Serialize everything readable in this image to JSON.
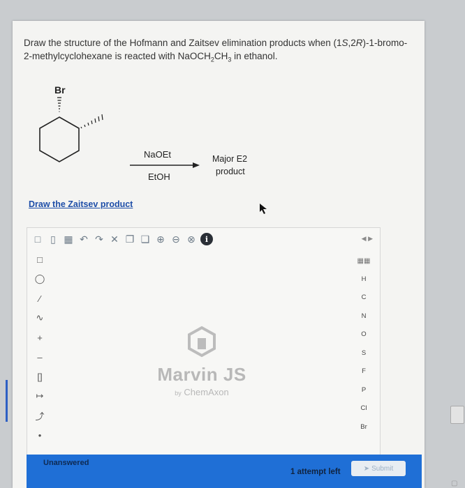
{
  "question": {
    "text_before": "Draw the structure of the Hofmann and Zaitsev elimination products when (1",
    "s_part": "S",
    "text_mid": ",2",
    "r_part": "R",
    "text_after": ")-1-bromo-2-methylcyclohexane is reacted with NaOCH",
    "sub1": "2",
    "ch": "CH",
    "sub2": "3",
    "text_end": " in ethanol."
  },
  "scheme": {
    "br_label": "Br",
    "reagent_top": "NaOEt",
    "reagent_bottom": "EtOH",
    "product_line1": "Major E2",
    "product_line2": "product"
  },
  "link_text": "Draw the Zaitsev product",
  "editor": {
    "logo_title": "Marvin JS",
    "logo_by": "by",
    "logo_sub": "ChemAxon",
    "elements": [
      "H",
      "C",
      "N",
      "O",
      "S",
      "F",
      "P",
      "Cl",
      "Br"
    ],
    "toolbar_icons": [
      "new-doc-icon",
      "open-folder-icon",
      "save-icon",
      "undo-icon",
      "redo-icon",
      "clear-icon",
      "copy-icon",
      "paste-icon",
      "zoom-in-icon",
      "zoom-out-icon",
      "zoom-fit-icon",
      "info-icon"
    ],
    "info_glyph": "i"
  },
  "bottom": {
    "status": "Unanswered",
    "attempts": "1 attempt left",
    "submit": "Submit"
  }
}
